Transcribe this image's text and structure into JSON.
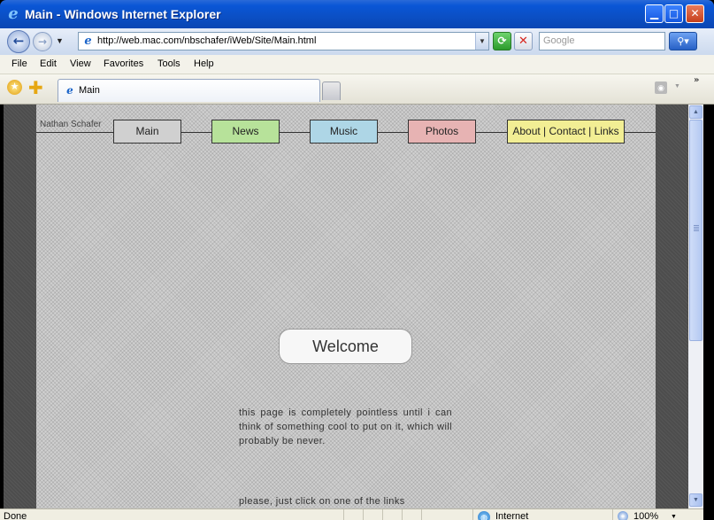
{
  "window": {
    "title": "Main - Windows Internet Explorer",
    "minimize_glyph": "▁",
    "maximize_glyph": "□",
    "close_glyph": "✕"
  },
  "toolbar": {
    "back_glyph": "←",
    "forward_glyph": "→",
    "history_dropdown_glyph": "▼",
    "address": "http://web.mac.com/nbschafer/iWeb/Site/Main.html",
    "refresh_glyph": "⟳",
    "stop_glyph": "✕",
    "search_placeholder": "Google",
    "search_glyph": "⚲▾"
  },
  "menu": [
    "File",
    "Edit",
    "View",
    "Favorites",
    "Tools",
    "Help"
  ],
  "tabs": {
    "active_label": "Main",
    "chevrons": "»"
  },
  "page": {
    "site_name": "Nathan Schafer",
    "nav": [
      {
        "label": "Main",
        "color": "#d0d0d0"
      },
      {
        "label": "News",
        "color": "#b7e29a"
      },
      {
        "label": "Music",
        "color": "#aed6e6"
      },
      {
        "label": "Photos",
        "color": "#e7b3b3"
      },
      {
        "label": "About | Contact | Links",
        "color": "#f2ee94"
      }
    ],
    "welcome": "Welcome",
    "blurb": "this page is completely pointless until i can think of something cool to put on it, which will probably be never.",
    "blurb2": "please, just click on one of the links"
  },
  "status": {
    "text": "Done",
    "zone": "Internet",
    "zoom": "100%"
  },
  "icons": {
    "ie_logo": "ie-logo-icon",
    "favorites": "star-icon",
    "add_favorite": "plus-icon",
    "rss": "rss-feed-icon",
    "globe": "globe-icon",
    "zoom": "zoom-icon"
  }
}
